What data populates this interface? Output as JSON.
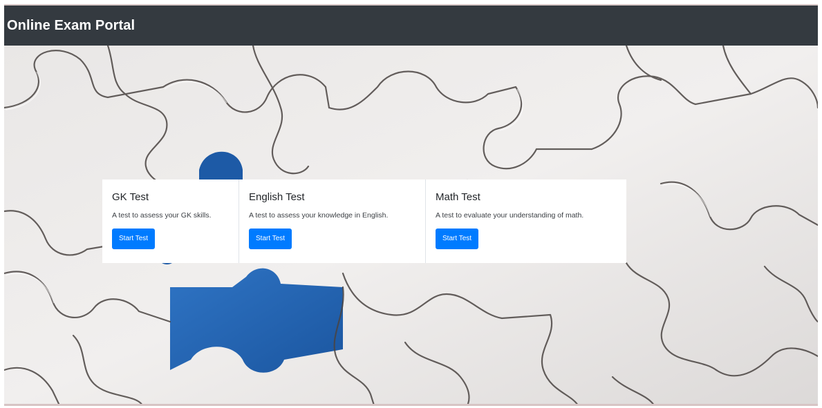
{
  "navbar": {
    "brand": "Online Exam Portal"
  },
  "tests": [
    {
      "title": "GK Test",
      "description": "A test to assess your GK skills.",
      "button_label": "Start Test"
    },
    {
      "title": "English Test",
      "description": "A test to assess your knowledge in English.",
      "button_label": "Start Test"
    },
    {
      "title": "Math Test",
      "description": "A test to evaluate your understanding of math.",
      "button_label": "Start Test"
    }
  ],
  "colors": {
    "navbar_bg": "#343a40",
    "button_bg": "#007bff",
    "puzzle_missing_piece": "#1f5fa8"
  },
  "background": {
    "image_icon": "puzzle-background-image"
  }
}
